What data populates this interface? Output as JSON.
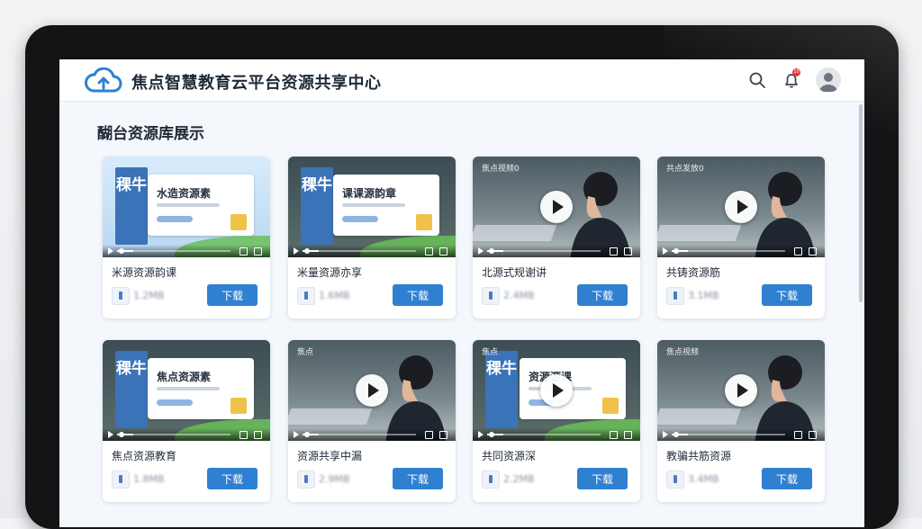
{
  "header": {
    "app_title": "焦点智慧教育云平台资源共享中心",
    "logo_icon": "cloud-upload-icon",
    "icons": [
      "search-icon",
      "bell-icon",
      "user-avatar-icon"
    ],
    "notification_badge": "10"
  },
  "section": {
    "title": "醐台资源库展示"
  },
  "colors": {
    "accent": "#2f80d1",
    "badge": "#e53935"
  },
  "cards": [
    {
      "kind": "doc",
      "book_text": "稞牛",
      "panel_title": "水造资源素",
      "title": "米源资源韵课",
      "meta": "1.2MB",
      "download_label": "下载"
    },
    {
      "kind": "docdark",
      "book_text": "稞牛",
      "panel_title": "课课源韵章",
      "title": "米量资源亦享",
      "meta": "1.6MB",
      "download_label": "下载"
    },
    {
      "kind": "video",
      "video_label": "焦点视频0",
      "title": "北源式规谢讲",
      "meta": "2.4MB",
      "download_label": "下载"
    },
    {
      "kind": "video",
      "video_label": "共点发放0",
      "title": "共铸资源筋",
      "meta": "3.1MB",
      "download_label": "下载"
    },
    {
      "kind": "docdark",
      "book_text": "稞牛",
      "panel_title": "焦点资源素",
      "title": "焦点资源教育",
      "meta": "1.8MB",
      "download_label": "下载"
    },
    {
      "kind": "video",
      "video_label": "焦点",
      "title": "资源共享中漏",
      "meta": "2.9MB",
      "download_label": "下载"
    },
    {
      "kind": "video-doc",
      "video_label": "焦点",
      "book_text": "稞牛",
      "panel_title": "资源源课",
      "title": "共同资源深",
      "meta": "2.2MB",
      "download_label": "下载"
    },
    {
      "kind": "video",
      "video_label": "焦点视频",
      "title": "教骗共筋资源",
      "meta": "3.4MB",
      "download_label": "下载"
    }
  ]
}
